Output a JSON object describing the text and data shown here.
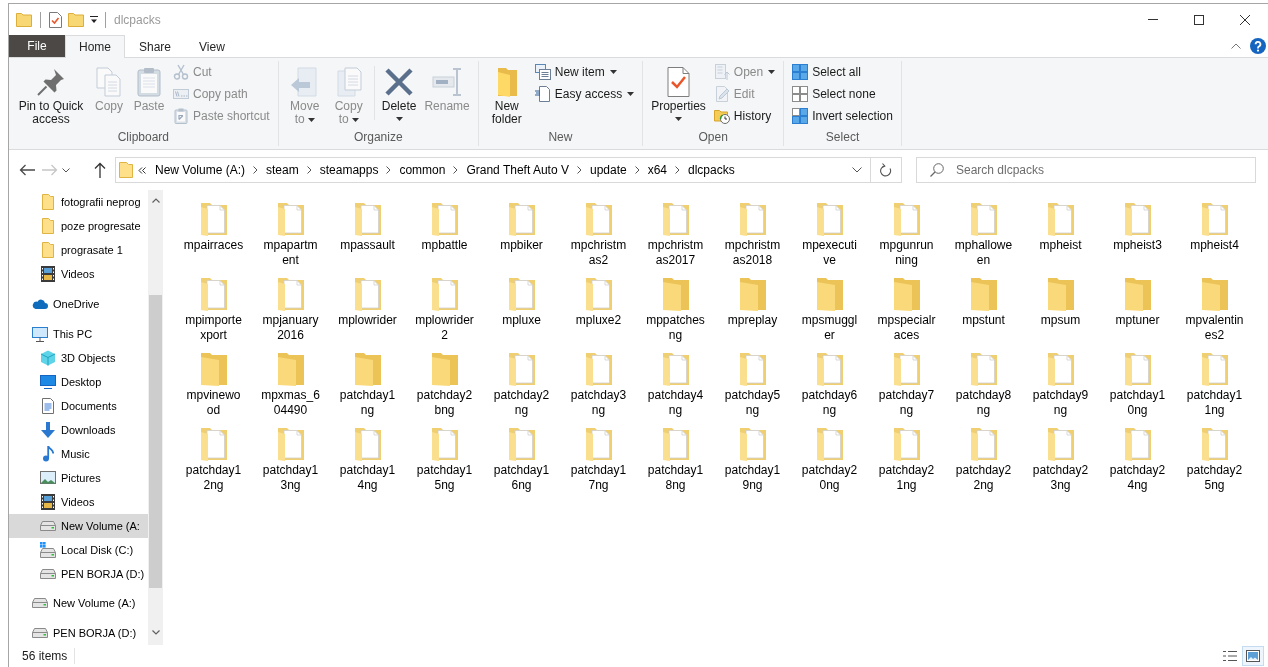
{
  "window": {
    "title": "dlcpacks",
    "active": false
  },
  "tabs": [
    {
      "label": "File",
      "kind": "menu",
      "selected": false
    },
    {
      "label": "Home",
      "kind": "tab",
      "selected": true
    },
    {
      "label": "Share",
      "kind": "tab",
      "selected": false
    },
    {
      "label": "View",
      "kind": "tab",
      "selected": false
    }
  ],
  "ribbon": {
    "groups": [
      {
        "label": "Clipboard",
        "sections": [
          {
            "buttons": [
              {
                "label": "Pin to Quick access",
                "kind": "large",
                "disabled": false,
                "menu": false
              },
              {
                "label": "Copy",
                "kind": "large",
                "disabled": true,
                "menu": false
              },
              {
                "label": "Paste",
                "kind": "large",
                "disabled": true,
                "menu": false
              },
              {
                "label": "Cut",
                "kind": "small",
                "disabled": true,
                "menu": false
              },
              {
                "label": "Copy path",
                "kind": "small",
                "disabled": true,
                "menu": false
              },
              {
                "label": "Paste shortcut",
                "kind": "small",
                "disabled": true,
                "menu": false
              }
            ]
          }
        ]
      },
      {
        "label": "Organize",
        "sections": [
          {
            "buttons": [
              {
                "label": "Move to",
                "kind": "large",
                "disabled": true,
                "menu": true
              },
              {
                "label": "Copy to",
                "kind": "large",
                "disabled": true,
                "menu": true
              }
            ]
          },
          {
            "buttons": [
              {
                "label": "Delete",
                "kind": "large",
                "disabled": false,
                "menu": true
              },
              {
                "label": "Rename",
                "kind": "large",
                "disabled": true,
                "menu": false
              }
            ]
          }
        ]
      },
      {
        "label": "New",
        "sections": [
          {
            "buttons": [
              {
                "label": "New folder",
                "kind": "large",
                "disabled": false,
                "menu": false
              },
              {
                "label": "New item",
                "kind": "small",
                "disabled": false,
                "menu": true
              },
              {
                "label": "Easy access",
                "kind": "small",
                "disabled": false,
                "menu": true
              }
            ]
          }
        ]
      },
      {
        "label": "Open",
        "sections": [
          {
            "buttons": [
              {
                "label": "Properties",
                "kind": "large",
                "disabled": false,
                "menu": true
              },
              {
                "label": "Open",
                "kind": "small",
                "disabled": true,
                "menu": true
              },
              {
                "label": "Edit",
                "kind": "small",
                "disabled": true,
                "menu": false
              },
              {
                "label": "History",
                "kind": "small",
                "disabled": false,
                "menu": false
              }
            ]
          }
        ]
      },
      {
        "label": "Select",
        "sections": [
          {
            "buttons": [
              {
                "label": "Select all",
                "kind": "small",
                "disabled": false,
                "menu": false
              },
              {
                "label": "Select none",
                "kind": "small",
                "disabled": false,
                "menu": false
              },
              {
                "label": "Invert selection",
                "kind": "small",
                "disabled": false,
                "menu": false
              }
            ]
          }
        ]
      }
    ]
  },
  "navigation": {
    "back_disabled": false,
    "forward_disabled": true
  },
  "address": {
    "crumbs": [
      "New Volume (A:)",
      "steam",
      "steamapps",
      "common",
      "Grand Theft Auto V",
      "update",
      "x64",
      "dlcpacks"
    ]
  },
  "search": {
    "placeholder": "Search dlcpacks"
  },
  "sidebar": {
    "items": [
      {
        "children": [
          {
            "label": "fotografii neprog",
            "kind": "folder",
            "selected": false
          },
          {
            "label": "poze progresate",
            "kind": "folder",
            "selected": false
          },
          {
            "label": "prograsate 1",
            "kind": "folder",
            "selected": false
          },
          {
            "label": "Videos",
            "kind": "videos",
            "selected": false
          }
        ]
      },
      {
        "label": "OneDrive",
        "kind": "cloud",
        "selected": false
      },
      {
        "label": "This PC",
        "kind": "computer",
        "selected": false,
        "children": [
          {
            "label": "3D Objects",
            "kind": "objects",
            "selected": false
          },
          {
            "label": "Desktop",
            "kind": "desktop",
            "selected": false
          },
          {
            "label": "Documents",
            "kind": "documents",
            "selected": false
          },
          {
            "label": "Downloads",
            "kind": "downloads",
            "selected": false
          },
          {
            "label": "Music",
            "kind": "music",
            "selected": false
          },
          {
            "label": "Pictures",
            "kind": "pictures",
            "selected": false
          },
          {
            "label": "Videos",
            "kind": "videos",
            "selected": false
          },
          {
            "label": "New Volume (A:",
            "kind": "drive",
            "selected": true
          },
          {
            "label": "Local Disk (C:)",
            "kind": "systemdrive",
            "selected": false
          },
          {
            "label": "PEN BORJA (D:)",
            "kind": "drive",
            "selected": false
          }
        ]
      },
      {
        "label": "New Volume (A:)",
        "kind": "drive",
        "selected": false
      },
      {
        "label": "PEN BORJA (D:)",
        "kind": "drive",
        "selected": false
      }
    ]
  },
  "content": {
    "items": [
      {
        "name": "mpairraces",
        "empty": false,
        "selected": false
      },
      {
        "name": "mpapartment",
        "empty": false,
        "selected": false
      },
      {
        "name": "mpassault",
        "empty": false,
        "selected": false
      },
      {
        "name": "mpbattle",
        "empty": false,
        "selected": false
      },
      {
        "name": "mpbiker",
        "empty": false,
        "selected": false
      },
      {
        "name": "mpchristmas2",
        "empty": false,
        "selected": false
      },
      {
        "name": "mpchristmas2017",
        "empty": false,
        "selected": false
      },
      {
        "name": "mpchristmas2018",
        "empty": false,
        "selected": false
      },
      {
        "name": "mpexecutive",
        "empty": false,
        "selected": false
      },
      {
        "name": "mpgunrunning",
        "empty": false,
        "selected": false
      },
      {
        "name": "mphalloween",
        "empty": false,
        "selected": false
      },
      {
        "name": "mpheist",
        "empty": false,
        "selected": false
      },
      {
        "name": "mpheist3",
        "empty": false,
        "selected": false
      },
      {
        "name": "mpheist4",
        "empty": false,
        "selected": false
      },
      {
        "name": "mpimportexport",
        "empty": false,
        "selected": false
      },
      {
        "name": "mpjanuary2016",
        "empty": false,
        "selected": false
      },
      {
        "name": "mplowrider",
        "empty": false,
        "selected": false
      },
      {
        "name": "mplowrider2",
        "empty": false,
        "selected": false
      },
      {
        "name": "mpluxe",
        "empty": false,
        "selected": false
      },
      {
        "name": "mpluxe2",
        "empty": false,
        "selected": false
      },
      {
        "name": "mppatchesng",
        "empty": true,
        "selected": false
      },
      {
        "name": "mpreplay",
        "empty": true,
        "selected": false
      },
      {
        "name": "mpsmuggler",
        "empty": true,
        "selected": false
      },
      {
        "name": "mpspecialraces",
        "empty": true,
        "selected": false
      },
      {
        "name": "mpstunt",
        "empty": true,
        "selected": false
      },
      {
        "name": "mpsum",
        "empty": true,
        "selected": false
      },
      {
        "name": "mptuner",
        "empty": true,
        "selected": false
      },
      {
        "name": "mpvalentines2",
        "empty": true,
        "selected": false
      },
      {
        "name": "mpvinewood",
        "empty": true,
        "selected": false
      },
      {
        "name": "mpxmas_604490",
        "empty": true,
        "selected": false
      },
      {
        "name": "patchday1ng",
        "empty": true,
        "selected": false
      },
      {
        "name": "patchday2bng",
        "empty": true,
        "selected": false
      },
      {
        "name": "patchday2ng",
        "empty": false,
        "selected": false
      },
      {
        "name": "patchday3ng",
        "empty": false,
        "selected": false
      },
      {
        "name": "patchday4ng",
        "empty": false,
        "selected": false
      },
      {
        "name": "patchday5ng",
        "empty": false,
        "selected": false
      },
      {
        "name": "patchday6ng",
        "empty": false,
        "selected": false
      },
      {
        "name": "patchday7ng",
        "empty": false,
        "selected": false
      },
      {
        "name": "patchday8ng",
        "empty": false,
        "selected": false
      },
      {
        "name": "patchday9ng",
        "empty": false,
        "selected": false
      },
      {
        "name": "patchday10ng",
        "empty": false,
        "selected": false
      },
      {
        "name": "patchday11ng",
        "empty": false,
        "selected": false
      },
      {
        "name": "patchday12ng",
        "empty": false,
        "selected": false
      },
      {
        "name": "patchday13ng",
        "empty": false,
        "selected": false
      },
      {
        "name": "patchday14ng",
        "empty": false,
        "selected": false
      },
      {
        "name": "patchday15ng",
        "empty": false,
        "selected": false
      },
      {
        "name": "patchday16ng",
        "empty": false,
        "selected": false
      },
      {
        "name": "patchday17ng",
        "empty": false,
        "selected": false
      },
      {
        "name": "patchday18ng",
        "empty": false,
        "selected": false
      },
      {
        "name": "patchday19ng",
        "empty": false,
        "selected": false
      },
      {
        "name": "patchday20ng",
        "empty": false,
        "selected": false
      },
      {
        "name": "patchday21ng",
        "empty": false,
        "selected": false
      },
      {
        "name": "patchday22ng",
        "empty": false,
        "selected": false
      },
      {
        "name": "patchday23ng",
        "empty": false,
        "selected": false
      },
      {
        "name": "patchday24ng",
        "empty": false,
        "selected": false
      },
      {
        "name": "patchday25ng",
        "empty": false,
        "selected": false
      }
    ]
  },
  "status_bar": {
    "item_count": "56 items",
    "views": [
      {
        "selected": false
      },
      {
        "selected": true
      }
    ]
  }
}
